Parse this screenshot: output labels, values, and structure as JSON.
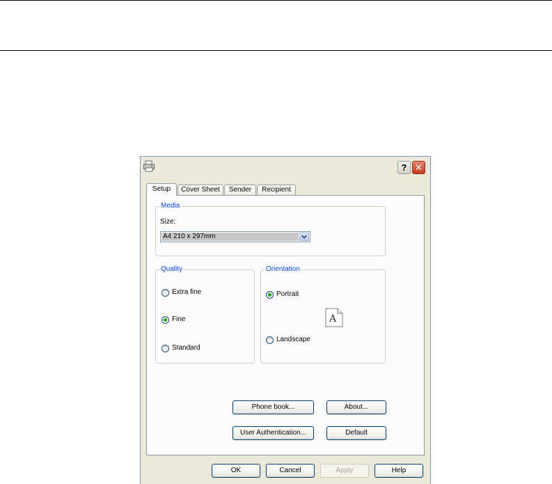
{
  "dialog": {
    "icon": "printer-icon",
    "help_label": "?",
    "close_label": "✕"
  },
  "tabs": [
    {
      "label": "Setup",
      "active": true
    },
    {
      "label": "Cover Sheet",
      "active": false
    },
    {
      "label": "Sender",
      "active": false
    },
    {
      "label": "Recipient",
      "active": false
    }
  ],
  "media": {
    "title": "Media",
    "size_label": "Size:",
    "size_value": "A4 210 x 297mm"
  },
  "quality": {
    "title": "Quality",
    "options": [
      {
        "label": "Extra fine",
        "checked": false
      },
      {
        "label": "Fine",
        "checked": true
      },
      {
        "label": "Standard",
        "checked": false
      }
    ]
  },
  "orientation": {
    "title": "Orientation",
    "portrait": "Portrait",
    "landscape": "Landscape",
    "selected": "Portrait",
    "page_letter": "A"
  },
  "buttons": {
    "phone_book": "Phone book...",
    "about": "About...",
    "user_auth": "User Authentication...",
    "default": "Default"
  },
  "footer": {
    "ok": "OK",
    "cancel": "Cancel",
    "apply": "Apply",
    "help": "Help"
  },
  "colors": {
    "accent": "#0046d5",
    "radio_checked": "#21a121",
    "dialog_bg": "#ece9d8"
  }
}
